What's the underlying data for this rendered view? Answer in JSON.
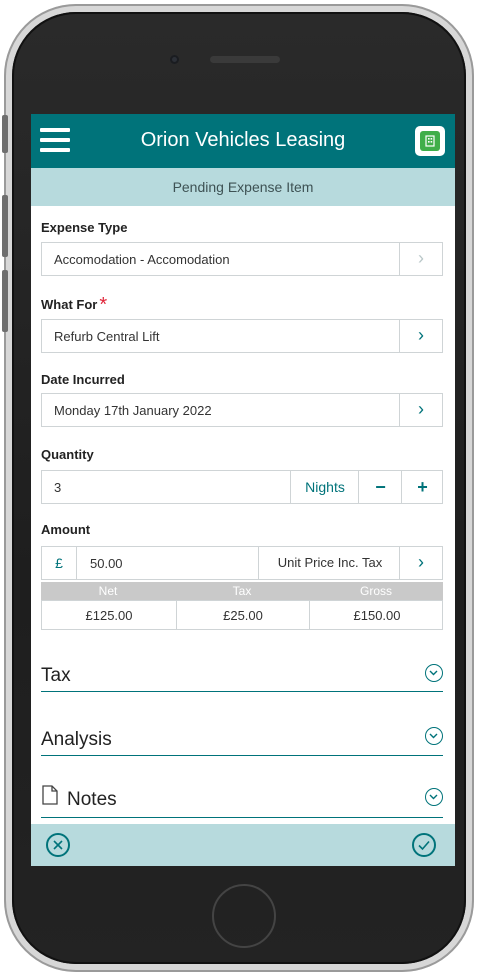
{
  "header": {
    "title": "Orion Vehicles Leasing",
    "subtitle": "Pending Expense Item"
  },
  "form": {
    "expense_type": {
      "label": "Expense Type",
      "value": "Accomodation - Accomodation"
    },
    "what_for": {
      "label": "What For",
      "value": "Refurb Central Lift",
      "required_mark": "*"
    },
    "date_incurred": {
      "label": "Date Incurred",
      "value": "Monday 17th January 2022"
    },
    "quantity": {
      "label": "Quantity",
      "value": "3",
      "unit": "Nights",
      "minus": "−",
      "plus": "+"
    },
    "amount": {
      "label": "Amount",
      "currency_symbol": "£",
      "value": "50.00",
      "mode": "Unit Price Inc. Tax"
    },
    "totals": {
      "headers": [
        "Net",
        "Tax",
        "Gross"
      ],
      "values": [
        "£125.00",
        "£25.00",
        "£150.00"
      ]
    }
  },
  "sections": {
    "tax": "Tax",
    "analysis": "Analysis",
    "notes": "Notes"
  },
  "icons": {
    "menu": "hamburger-icon",
    "logo": "app-logo-icon",
    "chevron": "chevron-right-icon",
    "expand": "chevron-down-circle-icon",
    "document": "document-icon",
    "cancel": "close-circle-icon",
    "confirm": "check-circle-icon"
  },
  "colors": {
    "primary": "#00737a",
    "light": "#b7dadd",
    "required": "#e0263a",
    "totals_header": "#c9c9c9"
  }
}
